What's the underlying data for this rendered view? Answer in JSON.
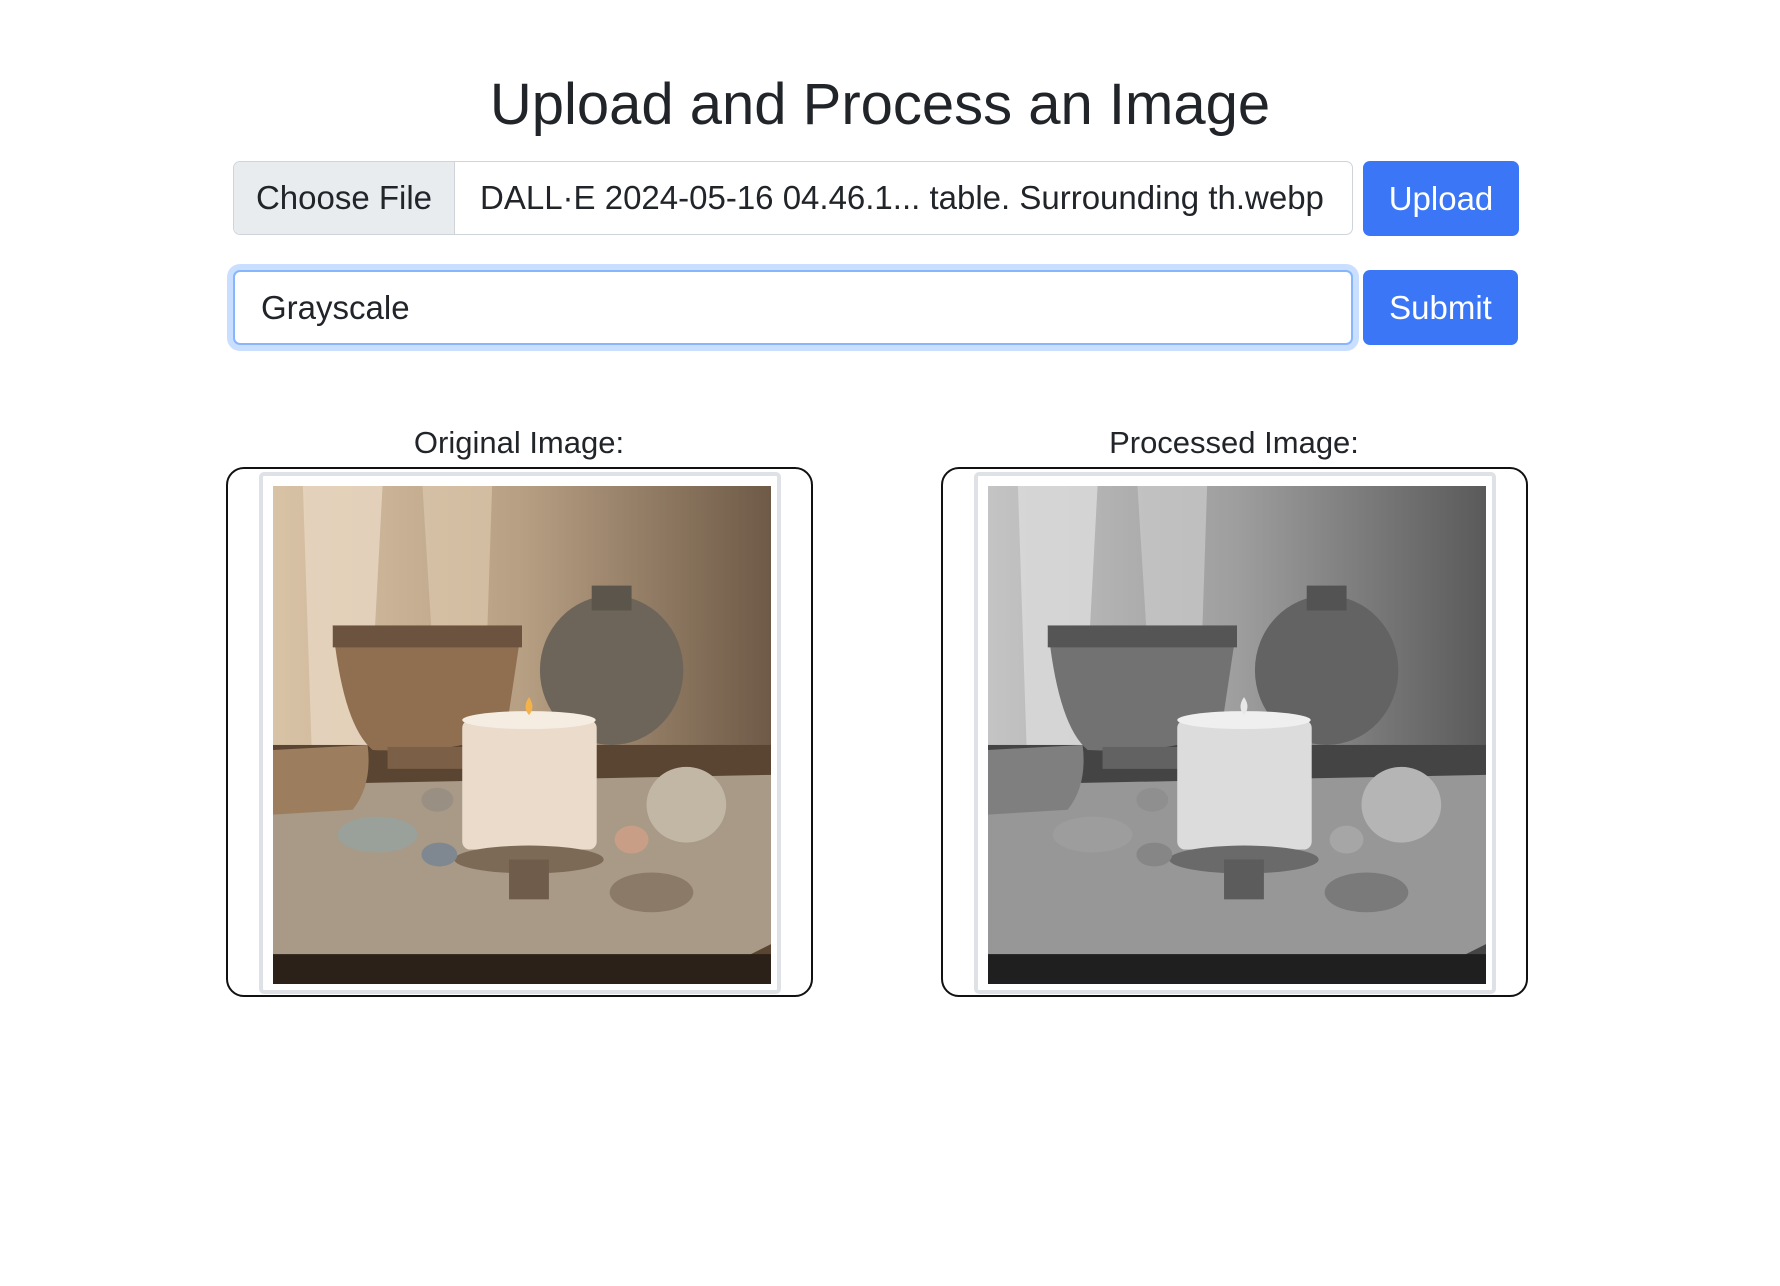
{
  "header": {
    "title": "Upload and Process an Image"
  },
  "upload_form": {
    "choose_label": "Choose File",
    "file_name": "DALL·E 2024-05-16 04.46.1... table. Surrounding th.webp",
    "upload_label": "Upload"
  },
  "process_form": {
    "operation_value": "Grayscale",
    "submit_label": "Submit"
  },
  "results": {
    "original_label": "Original Image:",
    "processed_label": "Processed Image:"
  },
  "colors": {
    "primary": "#3b76f6",
    "focus_ring": "#86b7fe"
  }
}
